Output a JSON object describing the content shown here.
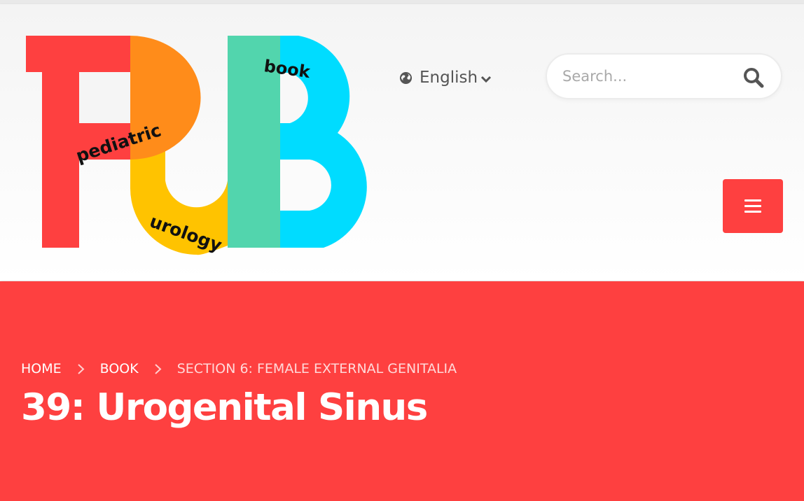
{
  "logo": {
    "letters": "PUB",
    "word_pediatric": "pediatric",
    "word_urology": "urology",
    "word_book": "book",
    "colors": {
      "red": "#fe4040",
      "orange": "#ff8c1a",
      "yellow": "#ffc300",
      "green": "#52d5ad",
      "cyan": "#00dcff"
    }
  },
  "header": {
    "language": {
      "label": "English",
      "icon": "globe-icon"
    },
    "search": {
      "placeholder": "Search...",
      "icon": "search-icon"
    },
    "menu_icon": "hamburger-icon"
  },
  "hero": {
    "breadcrumb": [
      {
        "label": "HOME"
      },
      {
        "label": "BOOK"
      },
      {
        "label": "SECTION 6: FEMALE EXTERNAL GENITALIA"
      }
    ],
    "title": "39: Urogenital Sinus",
    "accent": "#fe4040"
  }
}
